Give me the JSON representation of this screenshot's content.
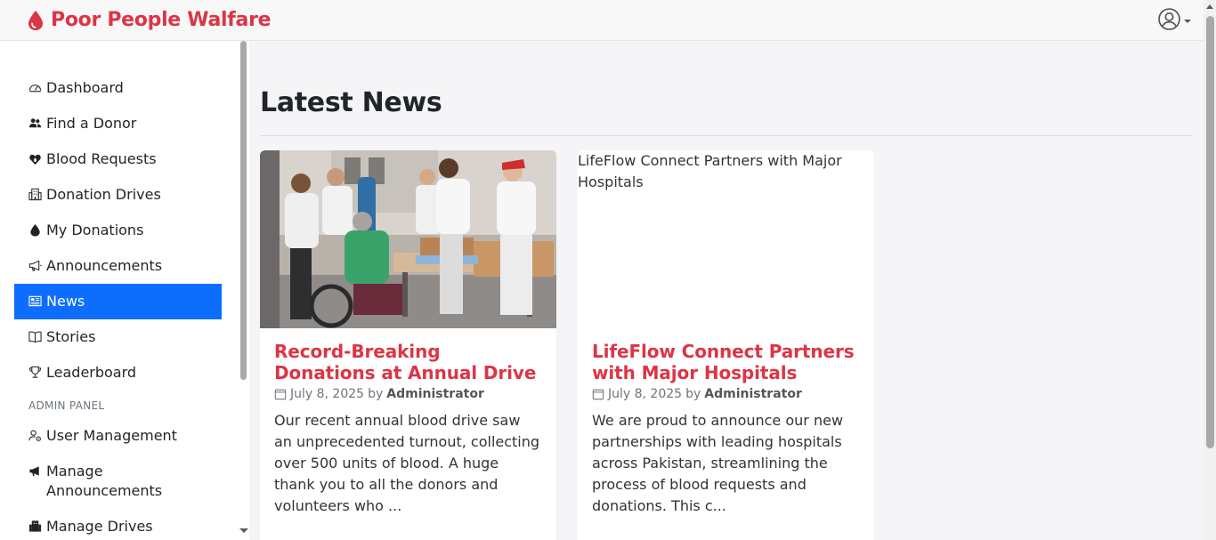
{
  "brand": {
    "name": "Poor People Walfare",
    "color": "#dc3545"
  },
  "sidebar": {
    "items": [
      {
        "label": "Dashboard",
        "icon": "speedometer-icon"
      },
      {
        "label": "Find a Donor",
        "icon": "people-icon"
      },
      {
        "label": "Blood Requests",
        "icon": "heart-drop-icon"
      },
      {
        "label": "Donation Drives",
        "icon": "building-icon"
      },
      {
        "label": "My Donations",
        "icon": "droplet-icon"
      },
      {
        "label": "Announcements",
        "icon": "megaphone-icon"
      },
      {
        "label": "News",
        "icon": "newspaper-icon",
        "active": true
      },
      {
        "label": "Stories",
        "icon": "book-icon"
      },
      {
        "label": "Leaderboard",
        "icon": "trophy-icon"
      }
    ],
    "admin_heading": "ADMIN PANEL",
    "admin_items": [
      {
        "label": "User Management",
        "icon": "person-gear-icon"
      },
      {
        "label": "Manage Announcements",
        "icon": "megaphone-fill-icon"
      },
      {
        "label": "Manage Drives",
        "icon": "building-fill-icon"
      }
    ]
  },
  "main": {
    "title": "Latest News",
    "articles": [
      {
        "title": "Record-Breaking Donations at Annual Drive",
        "date": "July 8, 2025",
        "by": "by",
        "author": "Administrator",
        "excerpt": "Our recent annual blood drive saw an unprecedented turnout, collecting over 500 units of blood. A huge thank you to all the donors and volunteers who ...",
        "image": "volunteers-photo"
      },
      {
        "title": "LifeFlow Connect Partners with Major Hospitals",
        "date": "July 8, 2025",
        "by": "by",
        "author": "Administrator",
        "excerpt": "We are proud to announce our new partnerships with leading hospitals across Pakistan, streamlining the process of blood requests and donations. This c...",
        "image_alt": "LifeFlow Connect Partners with Major Hospitals"
      }
    ]
  },
  "colors": {
    "active": "#0d6efd",
    "accent": "#dc3545"
  }
}
